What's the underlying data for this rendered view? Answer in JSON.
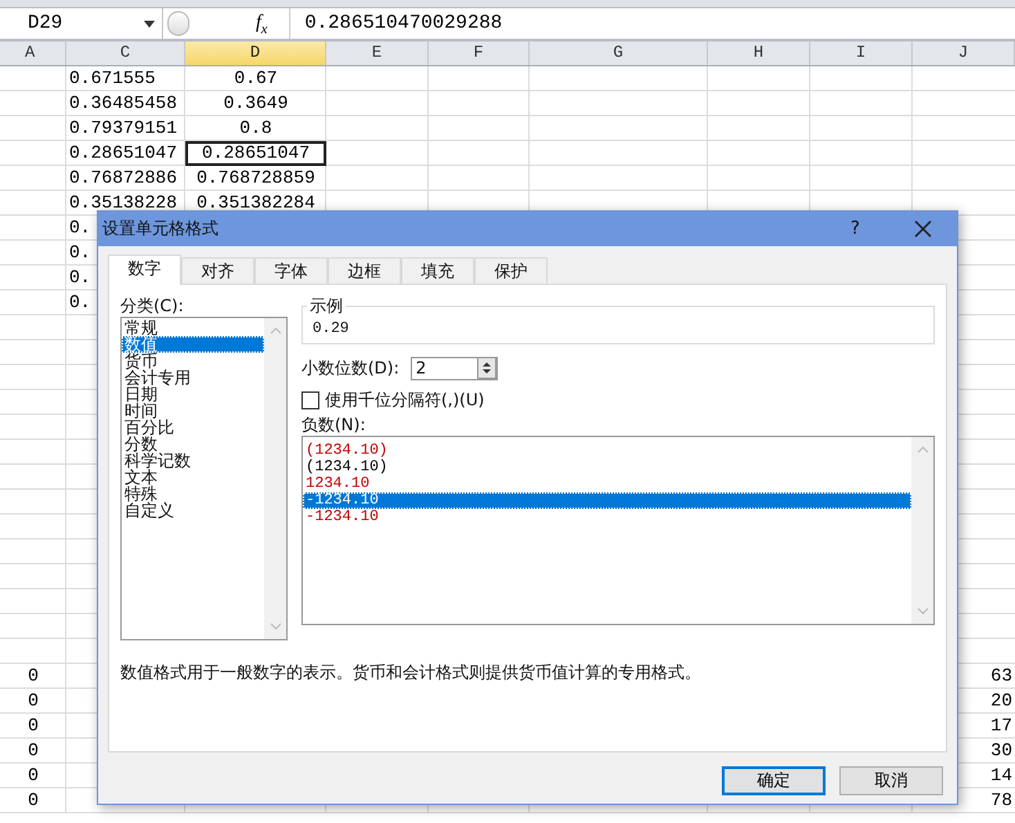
{
  "name_box": "D29",
  "function_button": "f$_{x}$",
  "formula": "0.286510470029288",
  "columns": [
    {
      "label": "A",
      "selected": false
    },
    {
      "label": "C",
      "selected": false
    },
    {
      "label": "D",
      "selected": true
    },
    {
      "label": "E",
      "selected": false
    },
    {
      "label": "F",
      "selected": false
    },
    {
      "label": "G",
      "selected": false
    },
    {
      "label": "H",
      "selected": false
    },
    {
      "label": "I",
      "selected": false
    },
    {
      "label": "J",
      "selected": false
    }
  ],
  "rows": [
    [
      null,
      {
        "text": "0.671555",
        "selected": false
      },
      {
        "text": "0.67",
        "selected": false
      },
      null,
      null,
      null,
      null,
      null,
      null
    ],
    [
      null,
      {
        "text": "0.36485458",
        "selected": false
      },
      {
        "text": "0.3649",
        "selected": false
      },
      null,
      null,
      null,
      null,
      null,
      null
    ],
    [
      null,
      {
        "text": "0.79379151",
        "selected": false
      },
      {
        "text": "0.8",
        "selected": false
      },
      null,
      null,
      null,
      null,
      null,
      null
    ],
    [
      null,
      {
        "text": "0.28651047",
        "selected": false
      },
      {
        "text": "0.28651047",
        "selected": true
      },
      null,
      null,
      null,
      null,
      null,
      null
    ],
    [
      null,
      {
        "text": "0.76872886",
        "selected": false
      },
      {
        "text": "0.768728859",
        "selected": false
      },
      null,
      null,
      null,
      null,
      null,
      null
    ],
    [
      null,
      {
        "text": "0.35138228",
        "selected": false
      },
      {
        "text": "0.351382284",
        "selected": false
      },
      null,
      null,
      null,
      null,
      null,
      null
    ],
    [
      null,
      {
        "text": "0.",
        "selected": false
      },
      null,
      null,
      null,
      null,
      null,
      null,
      null
    ],
    [
      null,
      {
        "text": "0.",
        "selected": false
      },
      null,
      null,
      null,
      null,
      null,
      null,
      null
    ],
    [
      null,
      {
        "text": "0.",
        "selected": false
      },
      null,
      null,
      null,
      null,
      null,
      null,
      null
    ],
    [
      null,
      {
        "text": "0.",
        "selected": false
      },
      null,
      null,
      null,
      null,
      null,
      null,
      null
    ],
    [
      null,
      null,
      null,
      null,
      null,
      null,
      null,
      null,
      null
    ],
    [
      null,
      null,
      null,
      null,
      null,
      null,
      null,
      null,
      null
    ],
    [
      null,
      null,
      null,
      null,
      null,
      null,
      null,
      null,
      null
    ],
    [
      null,
      null,
      null,
      null,
      null,
      null,
      null,
      null,
      null
    ],
    [
      null,
      null,
      null,
      null,
      null,
      null,
      null,
      null,
      null
    ],
    [
      null,
      null,
      null,
      null,
      null,
      null,
      null,
      null,
      null
    ],
    [
      null,
      null,
      null,
      null,
      null,
      null,
      null,
      null,
      null
    ],
    [
      null,
      null,
      null,
      null,
      null,
      null,
      null,
      null,
      null
    ],
    [
      null,
      null,
      null,
      null,
      null,
      null,
      null,
      null,
      null
    ],
    [
      null,
      null,
      null,
      null,
      null,
      null,
      null,
      null,
      null
    ],
    [
      null,
      null,
      null,
      null,
      null,
      null,
      null,
      null,
      null
    ],
    [
      null,
      null,
      null,
      null,
      null,
      null,
      null,
      null,
      null
    ],
    [
      null,
      null,
      null,
      null,
      null,
      null,
      null,
      null,
      null
    ],
    [
      null,
      null,
      null,
      null,
      null,
      null,
      null,
      null,
      null
    ],
    [
      {
        "text": "0",
        "selected": false
      },
      null,
      null,
      null,
      null,
      null,
      null,
      null,
      {
        "text": "63",
        "selected": false
      }
    ],
    [
      {
        "text": "0",
        "selected": false
      },
      null,
      null,
      null,
      null,
      null,
      null,
      null,
      {
        "text": "20",
        "selected": false
      }
    ],
    [
      {
        "text": "0",
        "selected": false
      },
      null,
      null,
      null,
      null,
      null,
      null,
      null,
      {
        "text": "17",
        "selected": false
      }
    ],
    [
      {
        "text": "0",
        "selected": false
      },
      null,
      null,
      null,
      null,
      null,
      null,
      null,
      {
        "text": "30",
        "selected": false
      }
    ],
    [
      {
        "text": "0",
        "selected": false
      },
      null,
      null,
      null,
      null,
      null,
      null,
      null,
      {
        "text": "14",
        "selected": false
      }
    ],
    [
      {
        "text": "0",
        "selected": false
      },
      null,
      null,
      null,
      null,
      null,
      null,
      null,
      {
        "text": "78",
        "selected": false
      }
    ]
  ],
  "dialog": {
    "title": "设置单元格格式",
    "help": "?",
    "tabs": [
      {
        "label": "数字",
        "selected": true
      },
      {
        "label": "对齐",
        "selected": false
      },
      {
        "label": "字体",
        "selected": false
      },
      {
        "label": "边框",
        "selected": false
      },
      {
        "label": "填充",
        "selected": false
      },
      {
        "label": "保护",
        "selected": false
      }
    ],
    "category_label": "分类(C):",
    "categories": [
      {
        "label": "常规",
        "selected": false
      },
      {
        "label": "数值",
        "selected": true
      },
      {
        "label": "货币",
        "selected": false
      },
      {
        "label": "会计专用",
        "selected": false
      },
      {
        "label": "日期",
        "selected": false
      },
      {
        "label": "时间",
        "selected": false
      },
      {
        "label": "百分比",
        "selected": false
      },
      {
        "label": "分数",
        "selected": false
      },
      {
        "label": "科学记数",
        "selected": false
      },
      {
        "label": "文本",
        "selected": false
      },
      {
        "label": "特殊",
        "selected": false
      },
      {
        "label": "自定义",
        "selected": false
      }
    ],
    "sample": {
      "label": "示例",
      "value": "0.29"
    },
    "decimal_places": {
      "label": "小数位数(D):",
      "value": "2"
    },
    "thousands_separator": {
      "label": "使用千位分隔符(,)(U)",
      "checked": false
    },
    "negative_numbers": {
      "label": "负数(N):",
      "items": [
        {
          "text": "(1234.10)",
          "color": "#c00000",
          "selected": false
        },
        {
          "text": "(1234.10)",
          "color": "#000000",
          "selected": false
        },
        {
          "text": "1234.10",
          "color": "#c00000",
          "selected": false
        },
        {
          "text": "-1234.10",
          "selected": true
        },
        {
          "text": "-1234.10",
          "color": "#c00000",
          "selected": false
        }
      ]
    },
    "description": "数值格式用于一般数字的表示。货币和会计格式则提供货币值计算的专用格式。",
    "buttons": [
      {
        "label": "确定",
        "default": true
      },
      {
        "label": "取消",
        "default": false
      }
    ]
  }
}
